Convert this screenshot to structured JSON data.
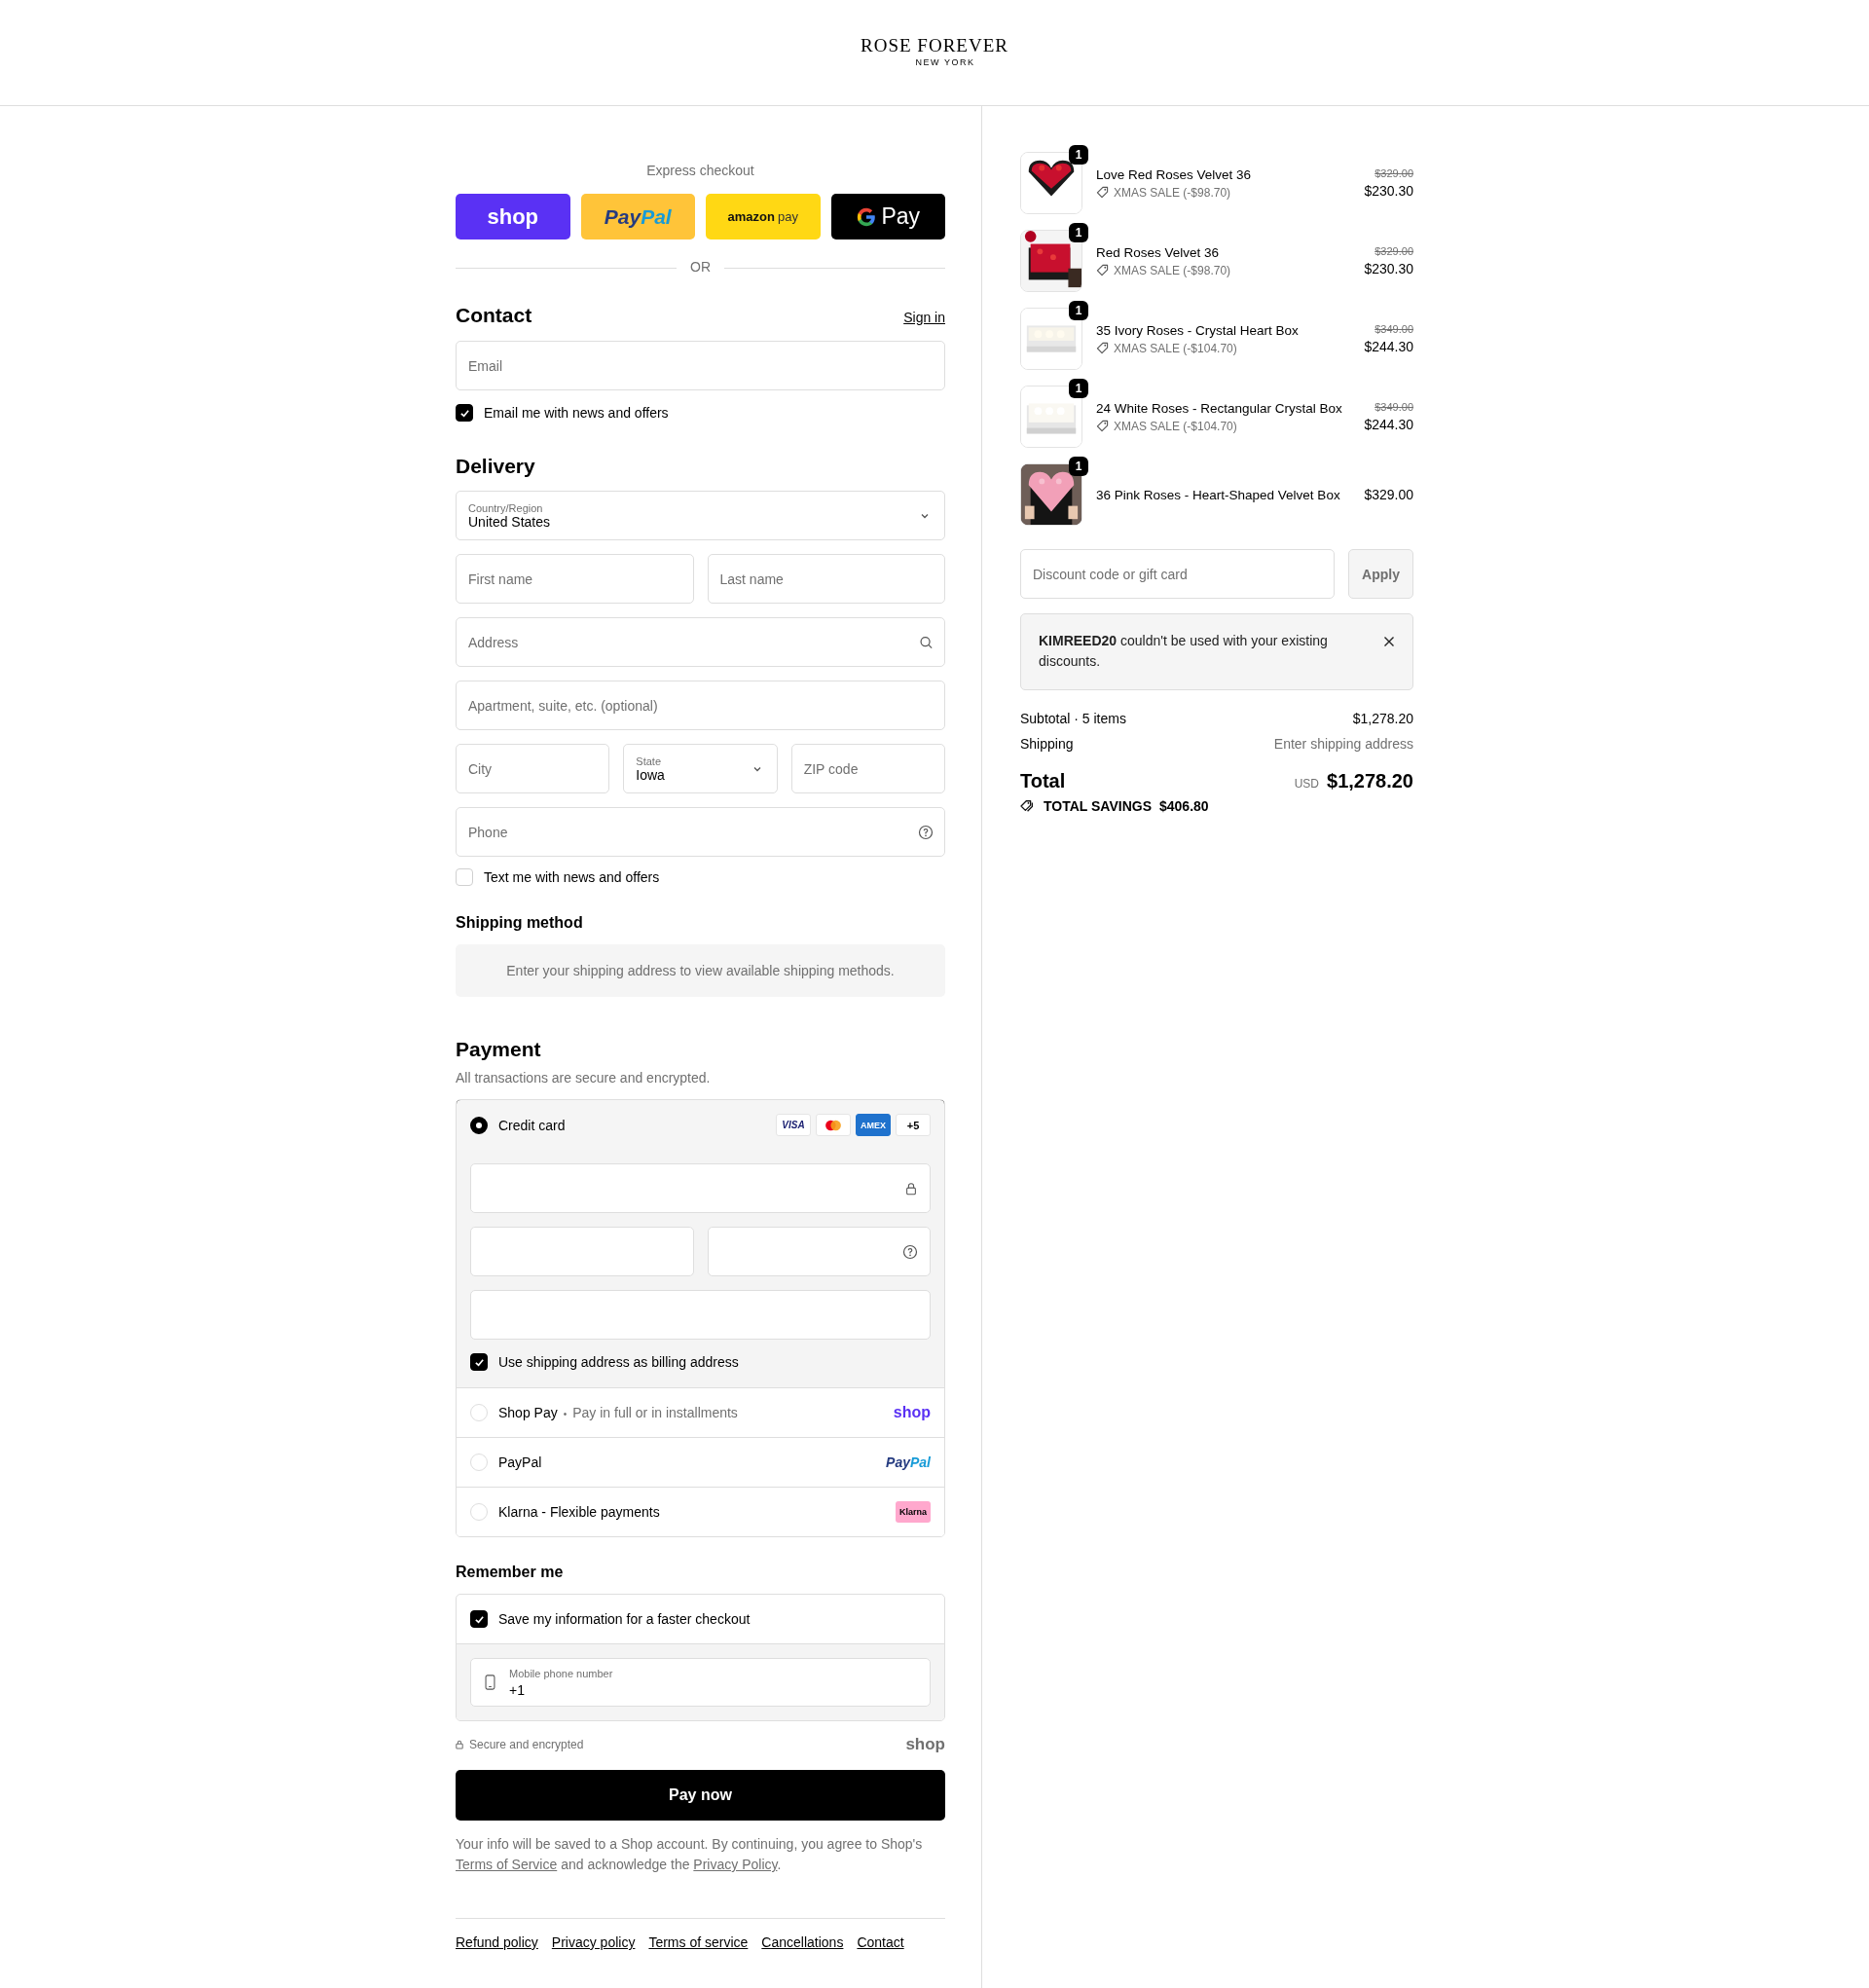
{
  "brand": {
    "name": "ROSE FOREVER",
    "location": "NEW YORK"
  },
  "express_checkout": {
    "title": "Express checkout",
    "divider": "OR",
    "buttons": [
      {
        "kind": "shop",
        "parts": [
          "shop"
        ]
      },
      {
        "kind": "paypal",
        "parts": [
          "Pay",
          "Pal"
        ]
      },
      {
        "kind": "amazon",
        "parts": [
          "amazon",
          "pay"
        ]
      },
      {
        "kind": "google",
        "parts": [
          "Pay"
        ]
      }
    ]
  },
  "contact": {
    "title": "Contact",
    "sign_in": "Sign in",
    "email": {
      "placeholder": "Email"
    },
    "newsletter": {
      "label": "Email me with news and offers",
      "checked": true
    }
  },
  "delivery": {
    "title": "Delivery",
    "rows": [
      [
        {
          "kind": "select",
          "label": "Country/Region",
          "value": "United States"
        }
      ],
      [
        {
          "kind": "text",
          "placeholder": "First name"
        },
        {
          "kind": "text",
          "placeholder": "Last name"
        }
      ],
      [
        {
          "kind": "search",
          "placeholder": "Address"
        }
      ],
      [
        {
          "kind": "text",
          "placeholder": "Apartment, suite, etc. (optional)"
        }
      ],
      [
        {
          "kind": "text",
          "placeholder": "City"
        },
        {
          "kind": "select",
          "label": "State",
          "value": "Iowa"
        },
        {
          "kind": "text",
          "placeholder": "ZIP code"
        }
      ],
      [
        {
          "kind": "help",
          "placeholder": "Phone"
        }
      ]
    ],
    "sms": {
      "label": "Text me with news and offers",
      "checked": false
    }
  },
  "shipping_method": {
    "title": "Shipping method",
    "message": "Enter your shipping address to view available shipping methods."
  },
  "payment": {
    "title": "Payment",
    "subtitle": "All transactions are secure and encrypted.",
    "methods": [
      {
        "kind": "card",
        "label": "Credit card",
        "selected": true,
        "brands": [
          {
            "kind": "visa",
            "label": "VISA"
          },
          {
            "kind": "mastercard"
          },
          {
            "kind": "amex",
            "label": "AMEX"
          },
          {
            "kind": "more",
            "label": "+5"
          }
        ],
        "fields": [
          [
            {
              "kind": "lock"
            }
          ],
          [
            {
              "kind": "plain"
            },
            {
              "kind": "help"
            }
          ],
          [
            {
              "kind": "plain"
            }
          ]
        ],
        "billing": {
          "label": "Use shipping address as billing address",
          "checked": true
        }
      },
      {
        "kind": "shop",
        "label": "Shop Pay",
        "separator": "•",
        "note": "Pay in full or in installments",
        "selected": false,
        "logo": [
          "shop"
        ]
      },
      {
        "kind": "paypal",
        "label": "PayPal",
        "selected": false,
        "logo": [
          "Pay",
          "Pal"
        ]
      },
      {
        "kind": "klarna",
        "label": "Klarna - Flexible payments",
        "selected": false,
        "logo": [
          "Klarna"
        ]
      }
    ]
  },
  "remember_me": {
    "title": "Remember me",
    "save": {
      "label": "Save my information for a faster checkout",
      "checked": true
    },
    "phone": {
      "label": "Mobile phone number",
      "value": "+1"
    }
  },
  "secure": {
    "label": "Secure and encrypted",
    "logo": "shop"
  },
  "pay_button": "Pay now",
  "disclaimer": [
    {
      "text": "Your info will be saved to a Shop account. By continuing, you agree to Shop's "
    },
    {
      "link": "Terms of Service"
    },
    {
      "text": " and acknowledge the "
    },
    {
      "link": "Privacy Policy"
    },
    {
      "text": "."
    }
  ],
  "footer_links": [
    "Refund policy",
    "Privacy policy",
    "Terms of service",
    "Cancellations",
    "Contact"
  ],
  "order": {
    "items": [
      {
        "name": "Love Red Roses Velvet 36",
        "quantity": "1",
        "discount": "XMAS SALE (-$98.70)",
        "original_price": "$329.00",
        "price": "$230.30"
      },
      {
        "name": "Red Roses Velvet 36",
        "quantity": "1",
        "discount": "XMAS SALE (-$98.70)",
        "original_price": "$329.00",
        "price": "$230.30"
      },
      {
        "name": "35 Ivory Roses - Crystal Heart Box",
        "quantity": "1",
        "discount": "XMAS SALE (-$104.70)",
        "original_price": "$349.00",
        "price": "$244.30"
      },
      {
        "name": "24 White Roses - Rectangular Crystal Box",
        "quantity": "1",
        "discount": "XMAS SALE (-$104.70)",
        "original_price": "$349.00",
        "price": "$244.30"
      },
      {
        "name": "36 Pink Roses - Heart-Shaped Velvet Box",
        "quantity": "1",
        "price": "$329.00"
      }
    ],
    "discount": {
      "placeholder": "Discount code or gift card",
      "apply": "Apply",
      "disabled": true
    },
    "alert": "**KIMREED20** couldn't be used with your existing discounts.",
    "subtotal": {
      "label": "Subtotal · 5 items",
      "value": "$1,278.20"
    },
    "shipping": {
      "label": "Shipping",
      "value": "Enter shipping address"
    },
    "total": {
      "label": "Total",
      "currency": "USD",
      "value": "$1,278.20"
    },
    "savings": {
      "label": "TOTAL SAVINGS",
      "value": "$406.80"
    }
  }
}
